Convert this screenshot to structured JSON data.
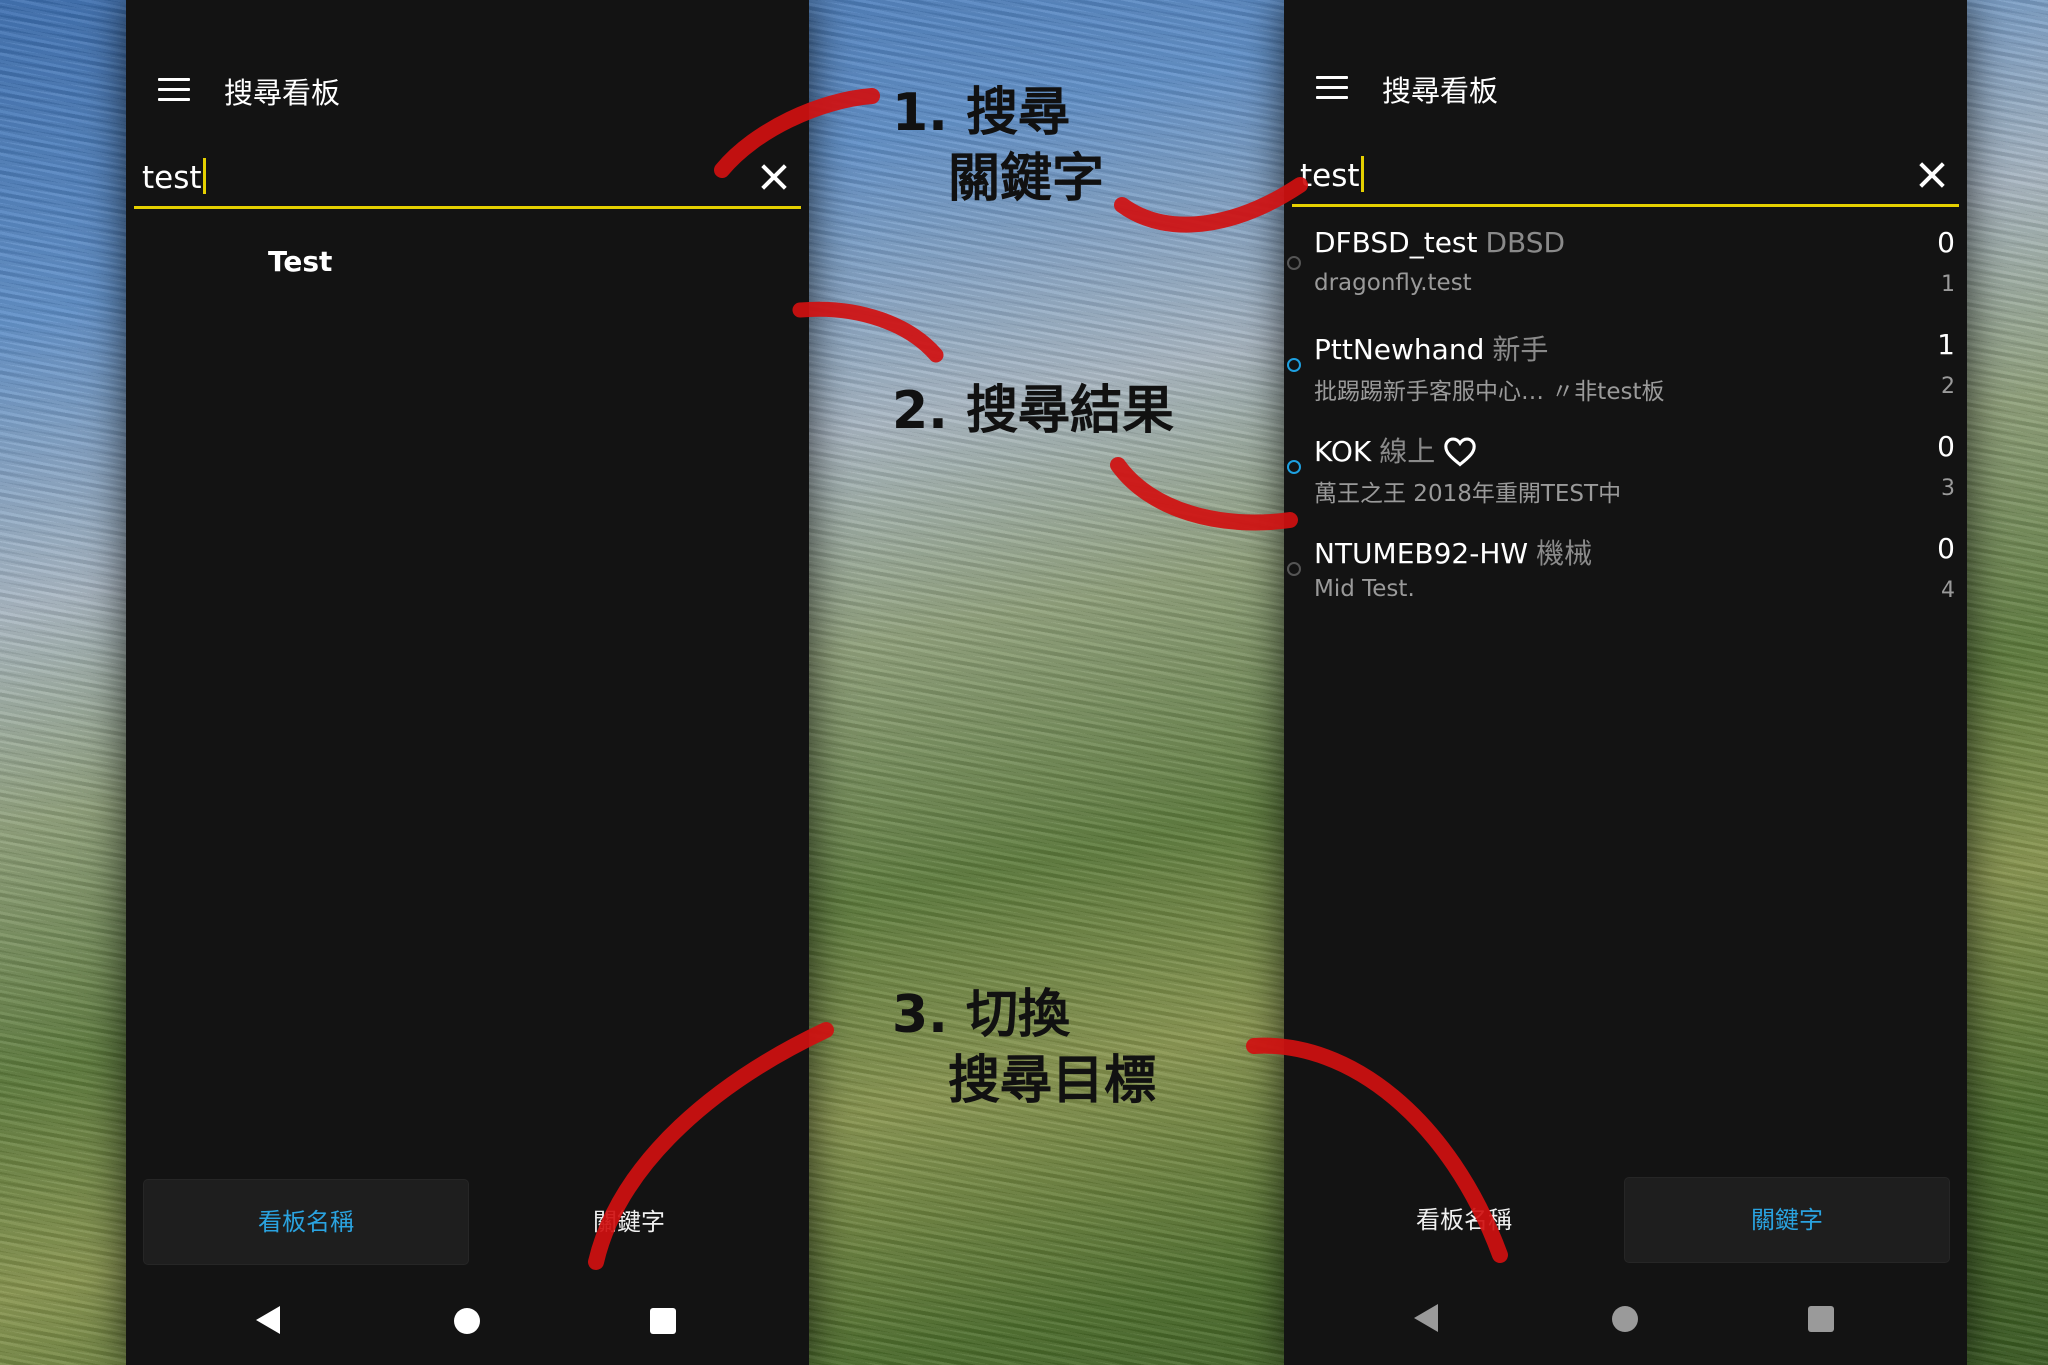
{
  "left_screen": {
    "title": "搜尋看板",
    "search_value": "test",
    "suggestion": "Test",
    "tabs": [
      {
        "label": "看板名稱",
        "active": true
      },
      {
        "label": "關鍵字",
        "active": false
      }
    ]
  },
  "right_screen": {
    "title": "搜尋看板",
    "search_value": "test",
    "boards": [
      {
        "name": "DFBSD_test",
        "category": "DBSD",
        "desc": "dragonfly.test",
        "count": "0",
        "sub": "1",
        "dot": "grey"
      },
      {
        "name": "PttNewhand",
        "category": "新手",
        "desc": "批踢踢新手客服中心… 〃非test板",
        "count": "1",
        "sub": "2",
        "dot": "blue"
      },
      {
        "name": "KOK",
        "category": "線上",
        "desc": "萬王之王 2018年重開TEST中",
        "count": "0",
        "sub": "3",
        "dot": "blue",
        "icon": "heart-icon"
      },
      {
        "name": "NTUMEB92-HW",
        "category": "機械",
        "desc": "Mid Test.",
        "count": "0",
        "sub": "4",
        "dot": "grey"
      }
    ],
    "tabs": [
      {
        "label": "看板名稱",
        "active": false
      },
      {
        "label": "關鍵字",
        "active": true
      }
    ]
  },
  "annotations": {
    "step1_line1": "1. 搜尋",
    "step1_line2": "關鍵字",
    "step2": "2. 搜尋結果",
    "step3_line1": "3. 切換",
    "step3_line2": "搜尋目標"
  },
  "colors": {
    "accent_yellow": "#e5d000",
    "active_tab_text": "#2aa3e0",
    "arrow_red": "#d01010",
    "panel_bg": "#131313"
  },
  "icons": [
    "menu-icon",
    "close-icon",
    "heart-icon",
    "back-icon",
    "home-icon",
    "recent-icon"
  ]
}
